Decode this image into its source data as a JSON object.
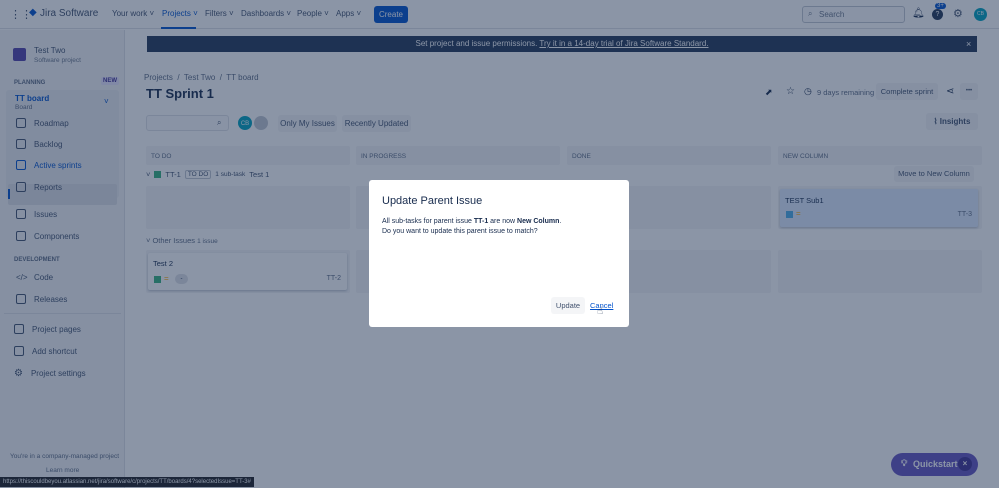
{
  "nav": {
    "product": "Jira Software",
    "items": [
      "Your work",
      "Projects",
      "Filters",
      "Dashboards",
      "People",
      "Apps"
    ],
    "create": "Create",
    "search_placeholder": "Search",
    "notif_badge": "3+",
    "avatar": "CB"
  },
  "sidebar": {
    "project_name": "Test Two",
    "project_type": "Software project",
    "planning": "PLANNING",
    "new_badge": "NEW",
    "board": "TT board",
    "board_sub": "Board",
    "items": [
      "Roadmap",
      "Backlog",
      "Active sprints",
      "Reports"
    ],
    "items2": [
      "Issues",
      "Components"
    ],
    "development": "DEVELOPMENT",
    "dev_items": [
      "Code",
      "Releases"
    ],
    "bottom_items": [
      "Project pages",
      "Add shortcut",
      "Project settings"
    ],
    "footer": "You're in a company-managed project",
    "learn_more": "Learn more"
  },
  "banner": {
    "text": "Set project and issue permissions.",
    "link": "Try it in a 14-day trial of Jira Software Standard.",
    "close": "×"
  },
  "breadcrumb": [
    "Projects",
    "Test Two",
    "TT board"
  ],
  "title": "TT Sprint 1",
  "header": {
    "remaining": "9 days remaining",
    "complete": "Complete sprint",
    "more": "•••",
    "insights": "Insights"
  },
  "filters": {
    "avatar": "CB",
    "only_mine": "Only My Issues",
    "recent": "Recently Updated"
  },
  "columns": [
    "TO DO",
    "IN PROGRESS",
    "DONE",
    "NEW COLUMN"
  ],
  "swimlane1": {
    "key": "TT-1",
    "status": "TO DO",
    "subtasks": "1 sub-task",
    "summary": "Test 1",
    "move": "Move to New Column"
  },
  "card_sub": {
    "title": "TEST Sub1",
    "key": "TT-3"
  },
  "swimlane2": {
    "label": "Other Issues",
    "count": "1 issue"
  },
  "card2": {
    "title": "Test 2",
    "key": "TT-2",
    "assignee": "-"
  },
  "dialog": {
    "title": "Update Parent Issue",
    "line1_pre": "All sub-tasks for parent issue ",
    "issue": "TT-1",
    "line1_mid": " are now ",
    "column": "New Column",
    "line1_post": ".",
    "line2": "Do you want to update this parent issue to match?",
    "update": "Update",
    "cancel": "Cancel"
  },
  "quickstart": {
    "label": "Quickstart",
    "close": "×"
  },
  "status_url": "https://thiscouldbeyou.atlassian.net/jira/software/c/projects/TT/boards/4?selectedIssue=TT-3#"
}
